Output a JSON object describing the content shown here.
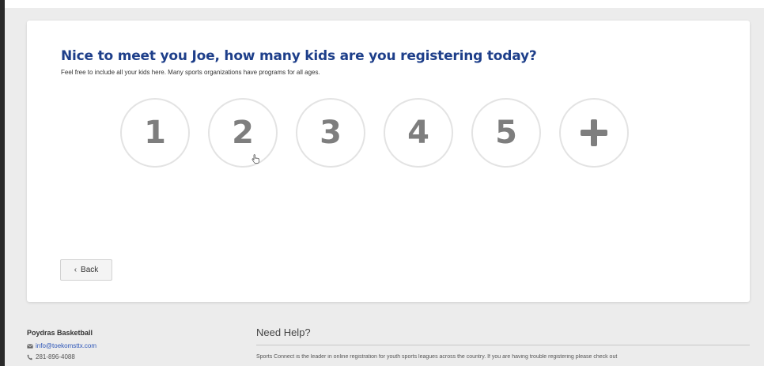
{
  "registration": {
    "title": "Nice to meet you Joe, how many kids are you registering today?",
    "subtitle": "Feel free to include all your kids here. Many sports organizations have programs for all ages.",
    "choices": [
      "1",
      "2",
      "3",
      "4",
      "5"
    ],
    "more_icon": "plus-icon",
    "back_label": "Back",
    "back_icon": "chevron-left-icon"
  },
  "footer": {
    "org_name": "Poydras Basketball",
    "email": "info@toekomsttx.com",
    "email_icon": "mail-icon",
    "phone": "281-896-4088",
    "phone_icon": "phone-icon",
    "help_heading": "Need Help?",
    "help_text": "Sports Connect is the leader in online registration for youth sports leagues across the country. If you are having trouble registering please check out"
  },
  "colors": {
    "title": "#1e3f8a",
    "choice_label": "#7e7e7e",
    "choice_border": "#e3e3e3",
    "link": "#2d56b8",
    "page_background": "#ececec"
  }
}
